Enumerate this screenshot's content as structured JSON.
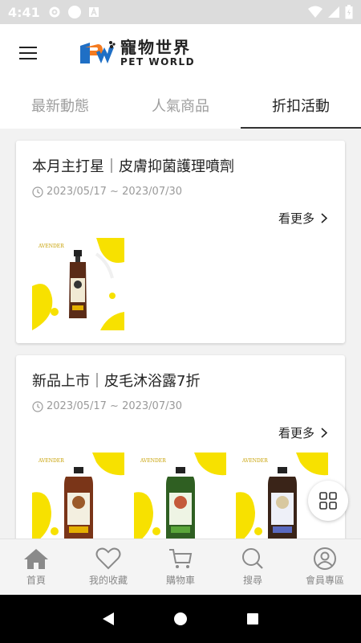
{
  "status_bar": {
    "time": "4:41"
  },
  "app": {
    "logo_cn": "寵物世界",
    "logo_en": "PET WORLD"
  },
  "tabs": [
    {
      "label": "最新動態"
    },
    {
      "label": "人氣商品"
    },
    {
      "label": "折扣活動",
      "active": true
    }
  ],
  "cards": [
    {
      "title": "本月主打星｜皮膚抑菌護理噴劑",
      "date": "2023/05/17 ~ 2023/07/30",
      "more": "看更多",
      "product_count": 1
    },
    {
      "title": "新品上市｜皮毛沐浴露7折",
      "date": "2023/05/17 ~ 2023/07/30",
      "more": "看更多",
      "product_count": 3
    }
  ],
  "bottom_nav": [
    {
      "label": "首頁",
      "icon": "home-icon"
    },
    {
      "label": "我的收藏",
      "icon": "heart-icon"
    },
    {
      "label": "購物車",
      "icon": "cart-icon"
    },
    {
      "label": "搜尋",
      "icon": "search-icon"
    },
    {
      "label": "會員專區",
      "icon": "user-icon"
    }
  ],
  "colors": {
    "accent_yellow": "#f7e100",
    "logo_orange": "#f47b20",
    "logo_blue": "#1f6fc5",
    "tab_active": "#222222",
    "tab_inactive": "#9e9e9e"
  }
}
